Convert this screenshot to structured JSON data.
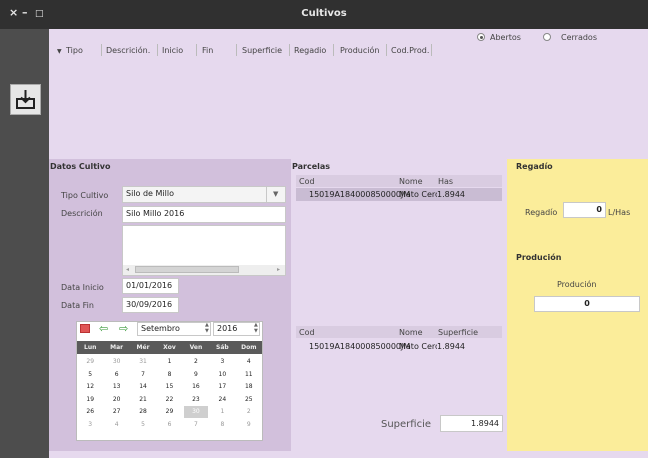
{
  "window": {
    "title": "Cultivos",
    "close_glyph": "×",
    "min_glyph": "–",
    "max_glyph": "□"
  },
  "filter": {
    "abertos": "Abertos",
    "cerrados": "Cerrados",
    "selected": "Abertos"
  },
  "main_table": {
    "columns": [
      "Tipo",
      "Descrición.",
      "Inicio",
      "Fin",
      "Superficie",
      "Regadio",
      "Produción",
      "Cod.Prod."
    ]
  },
  "datos": {
    "section": "Datos Cultivo",
    "tipo_label": "Tipo Cultivo",
    "tipo_value": "Silo de Millo",
    "desc_label": "Descrición",
    "desc_value": "Silo Millo 2016",
    "inicio_label": "Data Inicio",
    "inicio_value": "01/01/2016",
    "fin_label": "Data Fin",
    "fin_value": "30/09/2016"
  },
  "calendar": {
    "month": "Setembro",
    "year": "2016",
    "weekdays": [
      "Lun",
      "Mar",
      "Mér",
      "Xov",
      "Ven",
      "Sáb",
      "Dom"
    ],
    "weeks": [
      [
        "29",
        "30",
        "31",
        "1",
        "2",
        "3",
        "4"
      ],
      [
        "5",
        "6",
        "7",
        "8",
        "9",
        "10",
        "11"
      ],
      [
        "12",
        "13",
        "14",
        "15",
        "16",
        "17",
        "18"
      ],
      [
        "19",
        "20",
        "21",
        "22",
        "23",
        "24",
        "25"
      ],
      [
        "26",
        "27",
        "28",
        "29",
        "30",
        "1",
        "2"
      ],
      [
        "3",
        "4",
        "5",
        "6",
        "7",
        "8",
        "9"
      ]
    ],
    "selected_day": "30"
  },
  "parcelas": {
    "section": "Parcelas",
    "columns": [
      "Cod",
      "Nome",
      "Has"
    ],
    "rows": [
      [
        "15019A184000850000JM",
        "Mato Cerqu",
        "1.8944"
      ]
    ]
  },
  "parcelas2": {
    "columns": [
      "Cod",
      "Nome",
      "Superficie"
    ],
    "rows": [
      [
        "15019A184000850000JM",
        "Mato Cerqu",
        "1.8944"
      ]
    ]
  },
  "superficie": {
    "label": "Superficie",
    "value": "1.8944"
  },
  "regadio": {
    "section": "Regadío",
    "label": "Regadío",
    "value": "0",
    "unit": "L/Has"
  },
  "producion": {
    "section": "Produción",
    "label": "Produción",
    "value": "0"
  }
}
